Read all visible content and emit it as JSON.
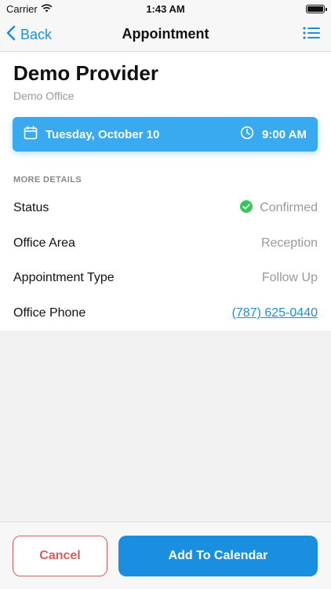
{
  "status_bar": {
    "carrier": "Carrier",
    "time": "1:43 AM"
  },
  "nav": {
    "back_label": "Back",
    "title": "Appointment"
  },
  "provider": {
    "name": "Demo Provider",
    "office": "Demo Office"
  },
  "banner": {
    "date": "Tuesday, October 10",
    "time": "9:00 AM",
    "color": "#3aaaf0"
  },
  "details": {
    "header": "MORE DETAILS",
    "rows": [
      {
        "label": "Status",
        "value": "Confirmed"
      },
      {
        "label": "Office Area",
        "value": "Reception"
      },
      {
        "label": "Appointment Type",
        "value": "Follow Up"
      },
      {
        "label": "Office Phone",
        "value": "(787) 625-0440"
      }
    ]
  },
  "footer": {
    "cancel_label": "Cancel",
    "add_label": "Add To Calendar"
  },
  "colors": {
    "accent": "#1a8fe0",
    "danger": "#e05a5a",
    "success": "#34c759"
  }
}
